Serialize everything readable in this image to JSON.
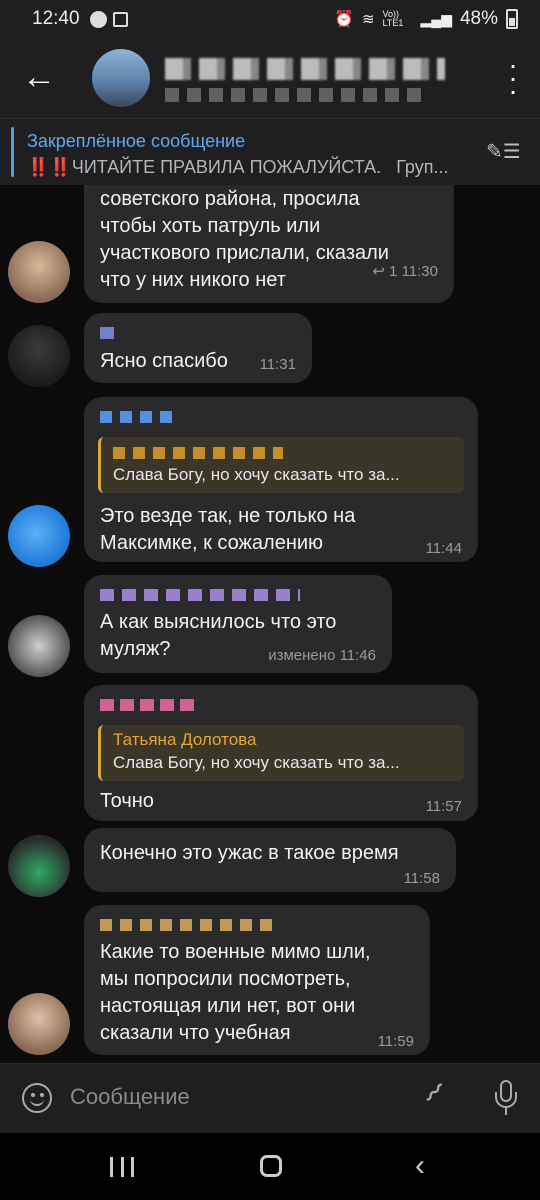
{
  "status_bar": {
    "time": "12:40",
    "lte_label": "Vo)) LTE1",
    "battery": "48%"
  },
  "header": {
    "back_icon": "arrow-left-icon",
    "menu_icon": "more-vertical-icon"
  },
  "pinned": {
    "title": "Закреплённое сообщение",
    "marks": "‼️‼️",
    "text": "ЧИТАЙТЕ ПРАВИЛА ПОЖАЛУЙСТА.",
    "suffix": "Груп..."
  },
  "messages": [
    {
      "text_lines": [
        "советского района, просила",
        "чтобы хоть патруль или",
        "участкового прислали, сказали",
        "что у них никого нет"
      ],
      "replies": "↩ 1",
      "time": "11:30"
    },
    {
      "text": "Ясно спасибо",
      "time": "11:31"
    },
    {
      "quote_text": "Слава Богу, но хочу сказать что за...",
      "text_lines": [
        "Это везде так, не только на",
        "Максимке, к сожалению"
      ],
      "time": "11:44"
    },
    {
      "text_lines": [
        "А как выяснилось что это",
        "муляж?"
      ],
      "time": "изменено 11:46"
    },
    {
      "quote_name": "Татьяна Долотова",
      "quote_text": "Слава Богу, но хочу сказать что за...",
      "text": "Точно",
      "time": "11:57"
    },
    {
      "text": "Конечно это ужас в такое время",
      "time": "11:58"
    },
    {
      "text_lines": [
        "Какие то военные мимо шли,",
        "мы попросили посмотреть,",
        "настоящая или нет, вот они",
        "сказали что учебная"
      ],
      "time": "11:59"
    }
  ],
  "input": {
    "placeholder": "Сообщение"
  },
  "colors": {
    "bubble": "#2a2a2d",
    "accent_blue": "#5eaaf0",
    "quote_name": "#e8a535",
    "background": "#0b0b0c"
  }
}
